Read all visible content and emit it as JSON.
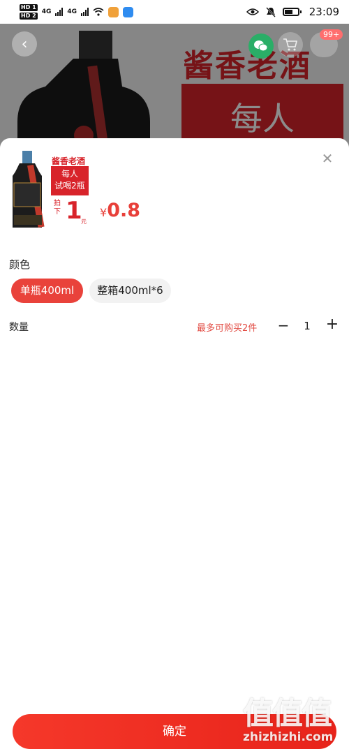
{
  "status_bar": {
    "hd1": "HD 1",
    "hd2": "HD 2",
    "net1": "4G",
    "net2": "4G",
    "time": "23:09"
  },
  "background": {
    "title": "酱香老酒",
    "red_box_text": "每人",
    "cart_badge": "99+"
  },
  "sheet": {
    "thumb_title": "酱香老酒",
    "thumb_line1": "每人",
    "thumb_line2": "试喝2瓶",
    "thumb_pai": "拍下",
    "thumb_one": "1",
    "thumb_yuan": "元",
    "price_currency": "¥",
    "price_value": "0.8",
    "close_icon": "close-icon",
    "color_label": "颜色",
    "options": [
      "单瓶400ml",
      "整箱400ml*6"
    ],
    "selected_option": "单瓶400ml",
    "quantity_label": "数量",
    "limit_text": "最多可购买2件",
    "quantity": "1",
    "minus": "−",
    "plus": "+"
  },
  "confirm_button": {
    "label": "确定"
  },
  "watermark": {
    "logo": "值值值",
    "text": "zhizhizhi.com"
  },
  "colors": {
    "accent": "#e9423b",
    "brand_red": "#d8232a"
  }
}
